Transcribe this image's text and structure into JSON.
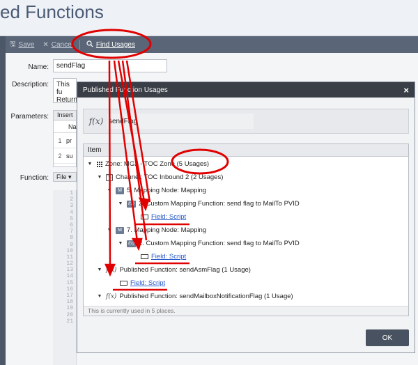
{
  "page": {
    "title": "ed Functions"
  },
  "toolbar": {
    "save_label": "Save",
    "cancel_label": "Cancel",
    "find_usages_label": "Find Usages"
  },
  "form": {
    "name_label": "Name:",
    "name_value": "sendFlag",
    "description_label": "Description:",
    "description_line1": "This fu",
    "description_line2": "Return",
    "parameters_label": "Parameters:",
    "insert_label": "Insert",
    "param_header": "Na",
    "param_rows": [
      {
        "num": "1",
        "name": "pr"
      },
      {
        "num": "2",
        "name": "su"
      }
    ],
    "function_label": "Function:",
    "file_label": "File ▾",
    "line_numbers": [
      "1",
      "2",
      "3",
      "4",
      "5",
      "6",
      "7",
      "8",
      "9",
      "10",
      "11",
      "12",
      "13",
      "14",
      "15",
      "16",
      "17",
      "18",
      "19",
      "20",
      "21"
    ]
  },
  "dialog": {
    "title": "Published Function Usages",
    "close_glyph": "×",
    "function_name": "sendFlag",
    "fx_glyph": "f(x)",
    "tree_header": "Item",
    "tree": [
      {
        "text": "Zone: MG2 - TOC Zone (5 Usages)",
        "icon": "zone-grid-icon"
      },
      {
        "text": "Channel: TOC Inbound 2 (2 Usages)",
        "icon": "channel-icon"
      },
      {
        "text": "5. Mapping Node: Mapping",
        "icon": "mapping-node-icon"
      },
      {
        "text": "2. Custom Mapping Function: send flag to MailTo PVID",
        "icon": "custom-function-icon"
      },
      {
        "text": "Field: Script",
        "icon": "field-icon"
      },
      {
        "text": "7. Mapping Node: Mapping",
        "icon": "mapping-node-icon"
      },
      {
        "text": "2. Custom Mapping Function: send flag to MailTo PVID",
        "icon": "custom-function-icon"
      },
      {
        "text": "Field: Script",
        "icon": "field-icon"
      },
      {
        "text": "Published Function: sendAsmFlag (1 Usage)",
        "icon": "fx-icon"
      },
      {
        "text": "Field: Script",
        "icon": "field-icon"
      },
      {
        "text": "Published Function: sendMailboxNotificationFlag (1 Usage)",
        "icon": "fx-icon"
      }
    ],
    "footer": "This is currently used in 5 places.",
    "ok_label": "OK"
  },
  "colors": {
    "annotation_red": "#e00000",
    "link_blue": "#2456c8",
    "toolbar_bg": "#5a6677",
    "dialog_title_bg": "#3a3f47"
  }
}
